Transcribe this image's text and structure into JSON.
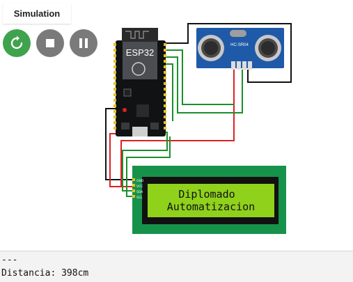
{
  "tab": {
    "label": "Simulation"
  },
  "controls": {
    "restart_icon": "restart-icon",
    "stop_icon": "stop-icon",
    "pause_icon": "pause-icon"
  },
  "esp32": {
    "label": "ESP32"
  },
  "sensor": {
    "label": "HC-SR04"
  },
  "lcd": {
    "line1": "Diplomado",
    "line2": "Automatizacion",
    "pins": [
      "GND",
      "VCC",
      "SDA",
      "SCL"
    ]
  },
  "serial": {
    "lines": [
      "---",
      "Distancia: 398cm"
    ]
  },
  "colors": {
    "run": "#3fa34d",
    "control_gray": "#7a7a7a",
    "lcd_pcb": "#16924a",
    "lcd_screen": "#8fd11b",
    "sensor_board": "#1f5aa8",
    "wire_green": "#1a8f2a",
    "wire_red": "#e02020"
  }
}
